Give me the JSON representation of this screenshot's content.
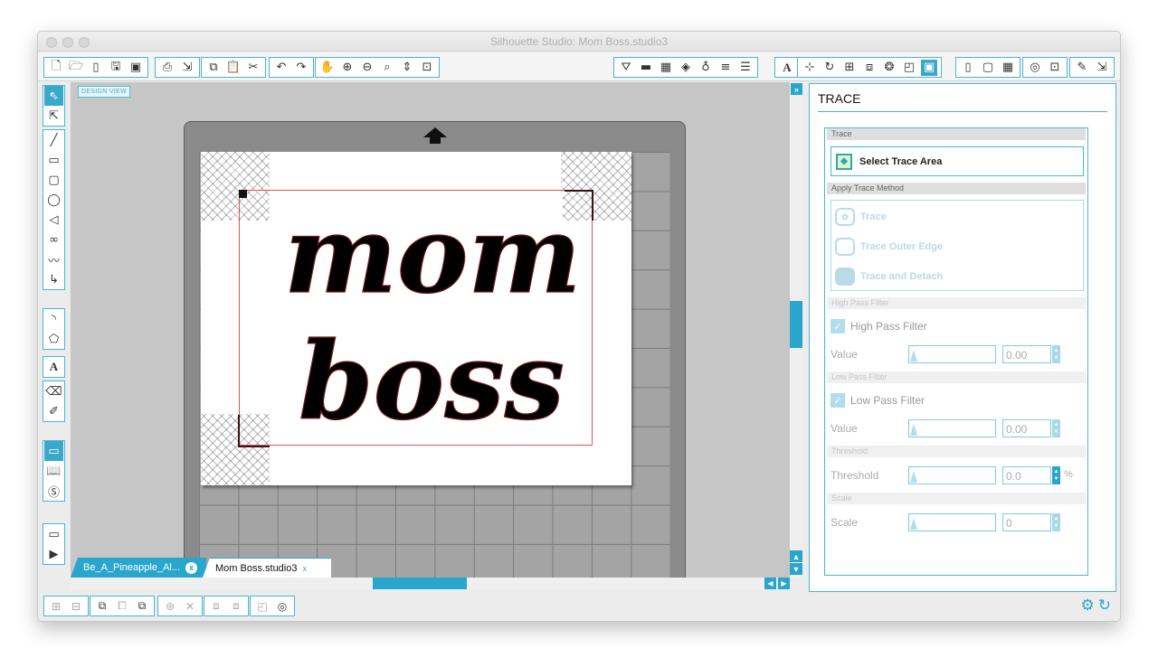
{
  "window": {
    "title": "Silhouette Studio: Mom Boss.studio3"
  },
  "toolbar": {
    "file_icons": [
      "new-icon",
      "open-icon",
      "library-icon",
      "save-icon",
      "save-as-icon"
    ],
    "print_icons": [
      "print-icon",
      "send-icon"
    ],
    "edit_icons": [
      "copy-icon",
      "paste-icon",
      "cut-icon"
    ],
    "undo_icons": [
      "undo-icon",
      "redo-icon"
    ],
    "view_icons": [
      "pan-icon",
      "zoom-in-icon",
      "zoom-out-icon",
      "zoom-select-icon",
      "drag-zoom-icon",
      "fit-page-icon"
    ]
  },
  "canvas": {
    "design_view_label": "DESIGN VIEW",
    "art_line1": "mom",
    "art_line2": "boss"
  },
  "tabs": [
    {
      "label": "Be_A_Pineapple_Al...",
      "close": "x"
    },
    {
      "label": "Mom Boss.studio3",
      "close": "x"
    }
  ],
  "trace_panel": {
    "title": "TRACE",
    "section_trace": "Trace",
    "select_area_label": "Select Trace Area",
    "section_method": "Apply Trace Method",
    "method_trace": "Trace",
    "method_outer_edge": "Trace Outer Edge",
    "method_detach": "Trace and Detach",
    "section_high_pass": "High Pass Filter",
    "high_pass_label": "High Pass Filter",
    "high_pass_checked": true,
    "high_pass_value_label": "Value",
    "high_pass_value": "0.00",
    "section_low_pass": "Low Pass Filter",
    "low_pass_label": "Low Pass Filter",
    "low_pass_checked": true,
    "low_pass_value_label": "Value",
    "low_pass_value": "0.00",
    "section_threshold": "Threshold",
    "threshold_label": "Threshold",
    "threshold_value": "0.0",
    "threshold_unit": "%",
    "section_scale": "Scale",
    "scale_label": "Scale",
    "scale_value": "0"
  },
  "colors": {
    "accent": "#2aa6cc",
    "selection_red": "#e05555"
  }
}
